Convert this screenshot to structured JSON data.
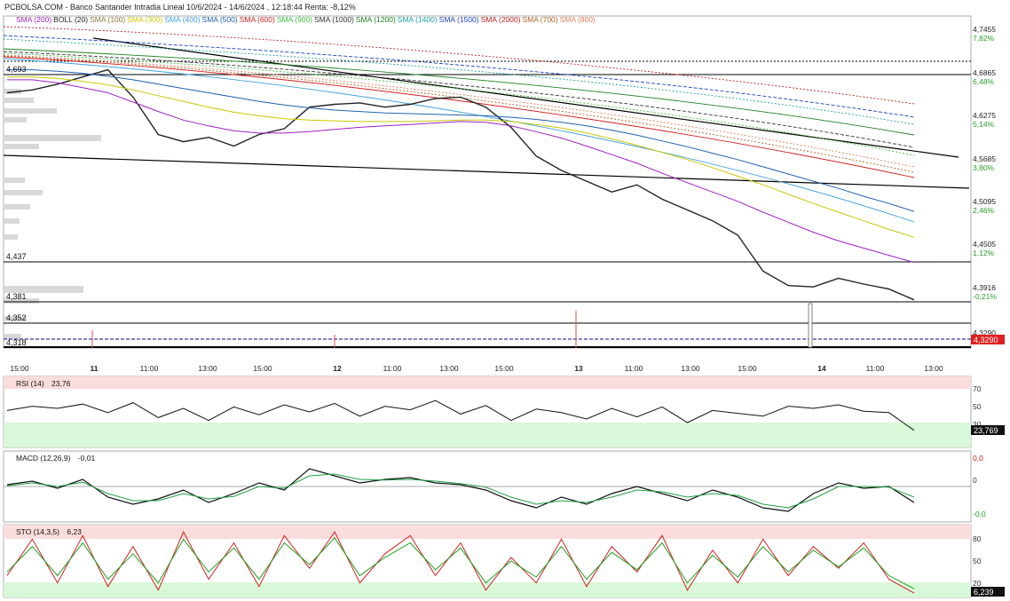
{
  "header": {
    "title": "PCBOLSA.COM - Banco Santander Intradia Lineal 10/6/2024 - 14/6/2024 , 12:18:44 Renta: -8,12%"
  },
  "legend": [
    {
      "label": "SMA (200)",
      "color": "#a020c0"
    },
    {
      "label": "BOLL (20)",
      "color": "#222222"
    },
    {
      "label": "SMA (100)",
      "color": "#8a7a3a"
    },
    {
      "label": "SMA (300)",
      "color": "#c8c800"
    },
    {
      "label": "SMA (400)",
      "color": "#40a0e0"
    },
    {
      "label": "SMA (500)",
      "color": "#2060b0"
    },
    {
      "label": "SMA (600)",
      "color": "#d02020"
    },
    {
      "label": "SMA (900)",
      "color": "#40c040"
    },
    {
      "label": "SMA (1000)",
      "color": "#333333"
    },
    {
      "label": "SMA (1200)",
      "color": "#208020"
    },
    {
      "label": "SMA (1400)",
      "color": "#20a0a0"
    },
    {
      "label": "SMA (1500)",
      "color": "#2040c0"
    },
    {
      "label": "SMA (2000)",
      "color": "#c02020"
    },
    {
      "label": "SMA (700)",
      "color": "#b06020"
    },
    {
      "label": "SMA (800)",
      "color": "#e08060"
    }
  ],
  "colors": {
    "price": "#222222",
    "boll_band": "#cfe3f7",
    "oversold_zone": "#d9f7d9",
    "overbought_zone": "#fbdcdc",
    "last_price_badge": "#e02020",
    "sto_k": "#d02020",
    "sto_d": "#20a020"
  },
  "chart_data": [
    {
      "type": "line",
      "panel": "price",
      "x_labels": [
        "15:00",
        "11",
        "11:00",
        "13:00",
        "15:00",
        "12",
        "11:00",
        "13:00",
        "15:00",
        "13",
        "11:00",
        "13:00",
        "15:00",
        "14",
        "11:00",
        "13:00"
      ],
      "y_ticks": [
        "4,7455",
        "4,6865",
        "4,6275",
        "4,5685",
        "4,5095",
        "4,4505",
        "4,3916",
        "4,3290"
      ],
      "pct_ticks": [
        "7,82%",
        "6,48%",
        "5,14%",
        "3,80%",
        "2,46%",
        "1,12%",
        "-0,21%"
      ],
      "horizontal_levels": [
        "4,693",
        "4,437",
        "4,381",
        "4,352",
        "4,318"
      ],
      "last_price": "4,3290",
      "ylim": [
        4.318,
        4.76
      ],
      "series": [
        {
          "name": "Precio",
          "values": [
            4.668,
            4.672,
            4.68,
            4.69,
            4.7,
            4.662,
            4.61,
            4.6,
            4.606,
            4.594,
            4.61,
            4.618,
            4.648,
            4.652,
            4.654,
            4.648,
            4.652,
            4.66,
            4.662,
            4.648,
            4.62,
            4.58,
            4.56,
            4.545,
            4.53,
            4.54,
            4.52,
            4.505,
            4.49,
            4.47,
            4.42,
            4.4,
            4.398,
            4.41,
            4.402,
            4.395,
            4.38
          ]
        },
        {
          "name": "SMA (200)",
          "values": [
            4.686,
            4.686,
            4.682,
            4.675,
            4.668,
            4.655,
            4.642,
            4.63,
            4.622,
            4.615,
            4.612,
            4.612,
            4.614,
            4.617,
            4.62,
            4.622,
            4.624,
            4.626,
            4.628,
            4.627,
            4.622,
            4.614,
            4.605,
            4.594,
            4.582,
            4.57,
            4.556,
            4.543,
            4.53,
            4.517,
            4.502,
            4.488,
            4.474,
            4.462,
            4.452,
            4.442,
            4.432
          ]
        },
        {
          "name": "SMA (300)",
          "values": [
            4.69,
            4.69,
            4.688,
            4.684,
            4.679,
            4.672,
            4.664,
            4.656,
            4.648,
            4.641,
            4.636,
            4.632,
            4.63,
            4.629,
            4.628,
            4.628,
            4.628,
            4.629,
            4.63,
            4.63,
            4.628,
            4.624,
            4.619,
            4.612,
            4.604,
            4.595,
            4.585,
            4.575,
            4.564,
            4.552,
            4.54,
            4.527,
            4.514,
            4.502,
            4.49,
            4.478,
            4.467
          ]
        },
        {
          "name": "SMA (500)",
          "values": [
            4.7,
            4.7,
            4.698,
            4.695,
            4.691,
            4.686,
            4.68,
            4.674,
            4.668,
            4.662,
            4.656,
            4.651,
            4.647,
            4.644,
            4.642,
            4.64,
            4.639,
            4.638,
            4.637,
            4.636,
            4.634,
            4.631,
            4.627,
            4.622,
            4.616,
            4.609,
            4.601,
            4.593,
            4.584,
            4.575,
            4.565,
            4.555,
            4.545,
            4.535,
            4.524,
            4.514,
            4.503
          ]
        }
      ]
    },
    {
      "type": "line",
      "panel": "rsi",
      "title": "RSI (14)",
      "last_value_label": "23,76",
      "badge_value": "23,769",
      "y_ticks": [
        "70",
        "50",
        "30"
      ],
      "ylim": [
        0,
        100
      ],
      "series": [
        {
          "name": "RSI",
          "values": [
            52,
            58,
            55,
            61,
            49,
            63,
            42,
            55,
            38,
            57,
            46,
            60,
            50,
            62,
            44,
            58,
            53,
            66,
            47,
            59,
            38,
            54,
            49,
            40,
            55,
            43,
            57,
            35,
            52,
            48,
            44,
            58,
            55,
            60,
            51,
            49,
            24
          ]
        }
      ]
    },
    {
      "type": "line",
      "panel": "macd",
      "title": "MACD (12,26,9)",
      "last_value_label": "-0,01",
      "y_ticks": [
        "0,0",
        "0",
        "-0,0"
      ],
      "ylim": [
        -1,
        1
      ],
      "series": [
        {
          "name": "MACD",
          "values": [
            0.05,
            0.15,
            -0.05,
            0.2,
            -0.3,
            -0.5,
            -0.35,
            -0.1,
            -0.45,
            -0.2,
            0.1,
            -0.1,
            0.5,
            0.3,
            0.1,
            0.2,
            0.25,
            0.1,
            0.05,
            -0.1,
            -0.4,
            -0.6,
            -0.3,
            -0.5,
            -0.2,
            0.0,
            -0.2,
            -0.4,
            -0.1,
            -0.3,
            -0.6,
            -0.7,
            -0.2,
            0.1,
            -0.05,
            0.0,
            -0.45
          ]
        },
        {
          "name": "Signal",
          "values": [
            0.02,
            0.1,
            0.0,
            0.12,
            -0.2,
            -0.4,
            -0.4,
            -0.2,
            -0.35,
            -0.28,
            0.0,
            -0.05,
            0.3,
            0.35,
            0.2,
            0.18,
            0.2,
            0.15,
            0.08,
            -0.02,
            -0.3,
            -0.5,
            -0.4,
            -0.45,
            -0.3,
            -0.1,
            -0.15,
            -0.3,
            -0.2,
            -0.25,
            -0.5,
            -0.6,
            -0.35,
            0.0,
            0.0,
            -0.02,
            -0.3
          ]
        }
      ]
    },
    {
      "type": "line",
      "panel": "sto",
      "title": "STO (14,3,5)",
      "last_value_label": "6,23",
      "badge_value": "6,239",
      "y_ticks": [
        "80",
        "50",
        "20"
      ],
      "ylim": [
        0,
        100
      ],
      "series": [
        {
          "name": "%K",
          "values": [
            30,
            80,
            20,
            85,
            15,
            70,
            10,
            90,
            25,
            75,
            15,
            85,
            40,
            90,
            20,
            60,
            85,
            30,
            75,
            10,
            55,
            20,
            80,
            15,
            70,
            35,
            85,
            10,
            65,
            20,
            80,
            30,
            70,
            40,
            75,
            25,
            6
          ]
        },
        {
          "name": "%D",
          "values": [
            35,
            70,
            30,
            75,
            25,
            60,
            20,
            80,
            35,
            68,
            25,
            75,
            45,
            82,
            30,
            55,
            75,
            38,
            68,
            20,
            50,
            28,
            70,
            25,
            62,
            38,
            75,
            20,
            58,
            28,
            70,
            35,
            65,
            42,
            68,
            30,
            12
          ]
        }
      ]
    }
  ]
}
